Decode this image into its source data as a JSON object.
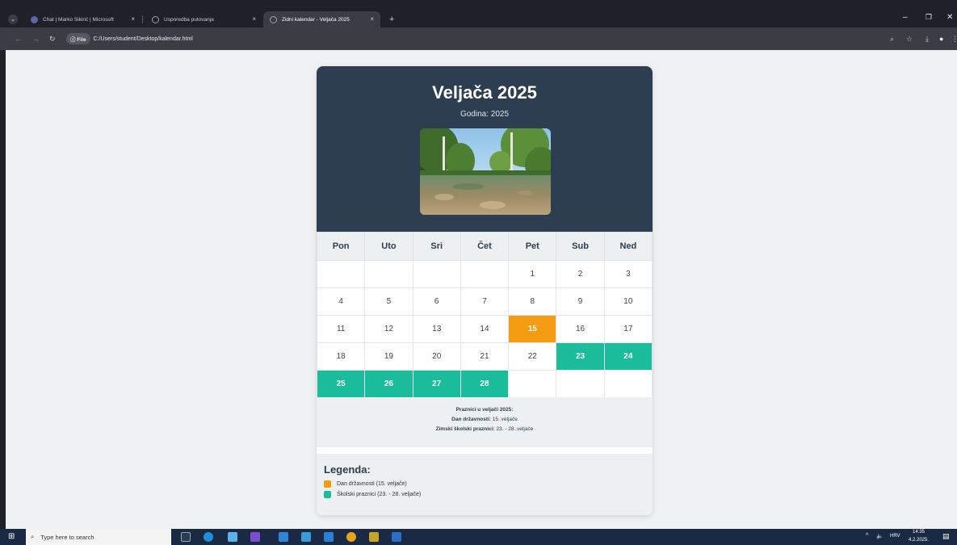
{
  "browser": {
    "tabs": [
      {
        "title": "Chat | Marko Sikirić | Microsoft",
        "close": "×"
      },
      {
        "title": "Usporedba putovanja",
        "close": "×"
      },
      {
        "title": "Zidni kalendar - Veljača 2025",
        "close": "×"
      }
    ],
    "new_tab": "+",
    "address_chip": "File",
    "url": "C:/Users/student/Desktop/kalendar.html"
  },
  "calendar": {
    "title": "Veljača 2025",
    "subtitle": "Godina: 2025",
    "weekdays": [
      "Pon",
      "Uto",
      "Sri",
      "Čet",
      "Pet",
      "Sub",
      "Ned"
    ],
    "weeks": [
      [
        "",
        "",
        "",
        "",
        "1",
        "2",
        "3"
      ],
      [
        "4",
        "5",
        "6",
        "7",
        "8",
        "9",
        "10"
      ],
      [
        "11",
        "12",
        "13",
        "14",
        "15",
        "16",
        "17"
      ],
      [
        "18",
        "19",
        "20",
        "21",
        "22",
        "23",
        "24"
      ],
      [
        "25",
        "26",
        "27",
        "28",
        "",
        "",
        ""
      ]
    ],
    "holiday_days": [
      "15"
    ],
    "school_break_days": [
      "23",
      "24",
      "25",
      "26",
      "27",
      "28"
    ],
    "colors": {
      "header": "#2c3e50",
      "holiday": "#f39c12",
      "school": "#1abc9c"
    },
    "notes": {
      "heading": "Praznici u veljači 2025:",
      "line1_label": "Dan državnosti:",
      "line1_value": " 15. veljače",
      "line2_label": "Zimski školski praznici:",
      "line2_value": " 23. - 28. veljače"
    },
    "legend": {
      "title": "Legenda:",
      "items": [
        "Dan državnosti (15. veljače)",
        "Školski praznici (23. - 28. veljače)"
      ]
    }
  },
  "taskbar": {
    "search_placeholder": "Type here to search",
    "language": "HRV",
    "time": "14:35",
    "date": "4.2.2025."
  }
}
